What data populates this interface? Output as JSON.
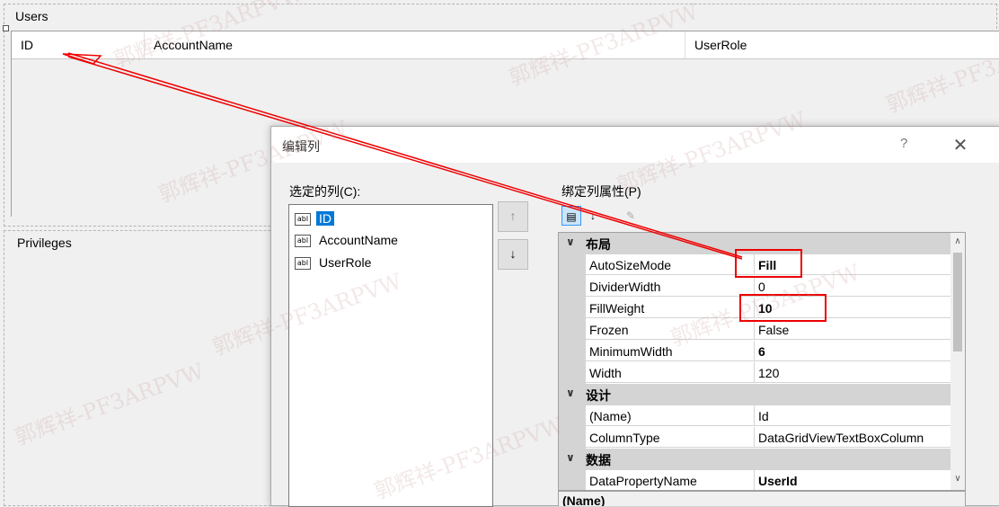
{
  "users_group": {
    "title": "Users",
    "columns": [
      "ID",
      "AccountName",
      "UserRole"
    ]
  },
  "privileges_group": {
    "title": "Privileges"
  },
  "dialog": {
    "title": "编辑列",
    "help": "?",
    "close": "✕",
    "selected_columns_label": "选定的列(C):",
    "bound_props_label": "绑定列属性(P)",
    "columns": [
      "ID",
      "AccountName",
      "UserRole"
    ],
    "selected_index": 0,
    "move_up": "↑",
    "move_down": "↓",
    "categories": {
      "layout": "布局",
      "design": "设计",
      "data": "数据"
    },
    "properties": {
      "layout": [
        {
          "name": "AutoSizeMode",
          "value": "Fill",
          "bold": true
        },
        {
          "name": "DividerWidth",
          "value": "0",
          "bold": false
        },
        {
          "name": "FillWeight",
          "value": "10",
          "bold": true
        },
        {
          "name": "Frozen",
          "value": "False",
          "bold": false
        },
        {
          "name": "MinimumWidth",
          "value": "6",
          "bold": true
        },
        {
          "name": "Width",
          "value": "120",
          "bold": false
        }
      ],
      "design": [
        {
          "name": "(Name)",
          "value": "Id",
          "bold": false
        },
        {
          "name": "ColumnType",
          "value": "DataGridViewTextBoxColumn",
          "bold": false
        }
      ],
      "data": [
        {
          "name": "DataPropertyName",
          "value": "UserId",
          "bold": true
        }
      ]
    },
    "description_title": "(Name)"
  },
  "watermark_text": "郭辉祥-PF3ARPVW",
  "colors": {
    "selection": "#0078d7",
    "highlight": "#ee0000",
    "category_bg": "#d4d4d4"
  }
}
